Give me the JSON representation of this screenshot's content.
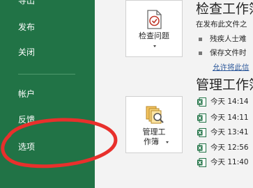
{
  "sidebar": {
    "items": [
      {
        "label": "导出"
      },
      {
        "label": "发布"
      },
      {
        "label": "关闭"
      },
      {
        "label": "帐户"
      },
      {
        "label": "反馈"
      },
      {
        "label": "选项"
      }
    ]
  },
  "inspect": {
    "button_label": "检查问题",
    "title": "检查工作簿",
    "description": "在发布此文件之",
    "bullets": [
      "残疾人士难",
      "保存文件时"
    ],
    "link": "允许将此信"
  },
  "manage": {
    "button_label_line1": "管理工",
    "button_label_line2": "作簿",
    "title": "管理工作簿",
    "versions": [
      "今天 14:14",
      "今天 14:11",
      "今天 13:41",
      "今天 12:56",
      "今天 11:40"
    ]
  },
  "colors": {
    "sidebar_bg": "#217346",
    "highlight_circle": "#e8302c",
    "link": "#2b579a"
  }
}
